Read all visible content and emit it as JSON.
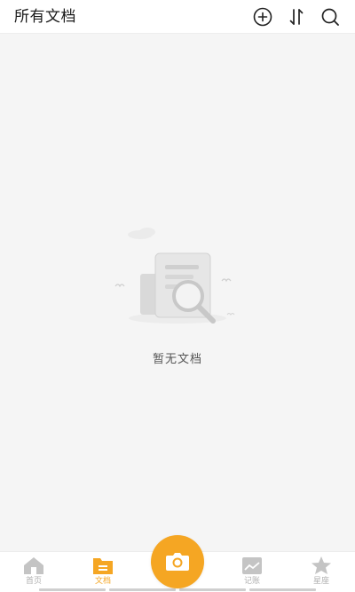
{
  "header": {
    "title": "所有文档",
    "actions": [
      {
        "name": "add-icon"
      },
      {
        "name": "sort-icon"
      },
      {
        "name": "search-icon"
      }
    ]
  },
  "empty_state": {
    "message": "暂无文档",
    "illustration": "document-search-illustration"
  },
  "tabbar": {
    "items": [
      {
        "label": "首页",
        "icon": "home-icon",
        "active": false
      },
      {
        "label": "文档",
        "icon": "document-folder-icon",
        "active": true
      },
      {
        "label": "记账",
        "icon": "ledger-icon",
        "active": false
      },
      {
        "label": "星座",
        "icon": "star-icon",
        "active": false
      }
    ],
    "center_button": {
      "icon": "camera-icon"
    }
  },
  "colors": {
    "accent": "#f5a623",
    "background": "#f5f5f5",
    "header_bg": "#ffffff",
    "inactive_icon": "#c4c4c4"
  }
}
